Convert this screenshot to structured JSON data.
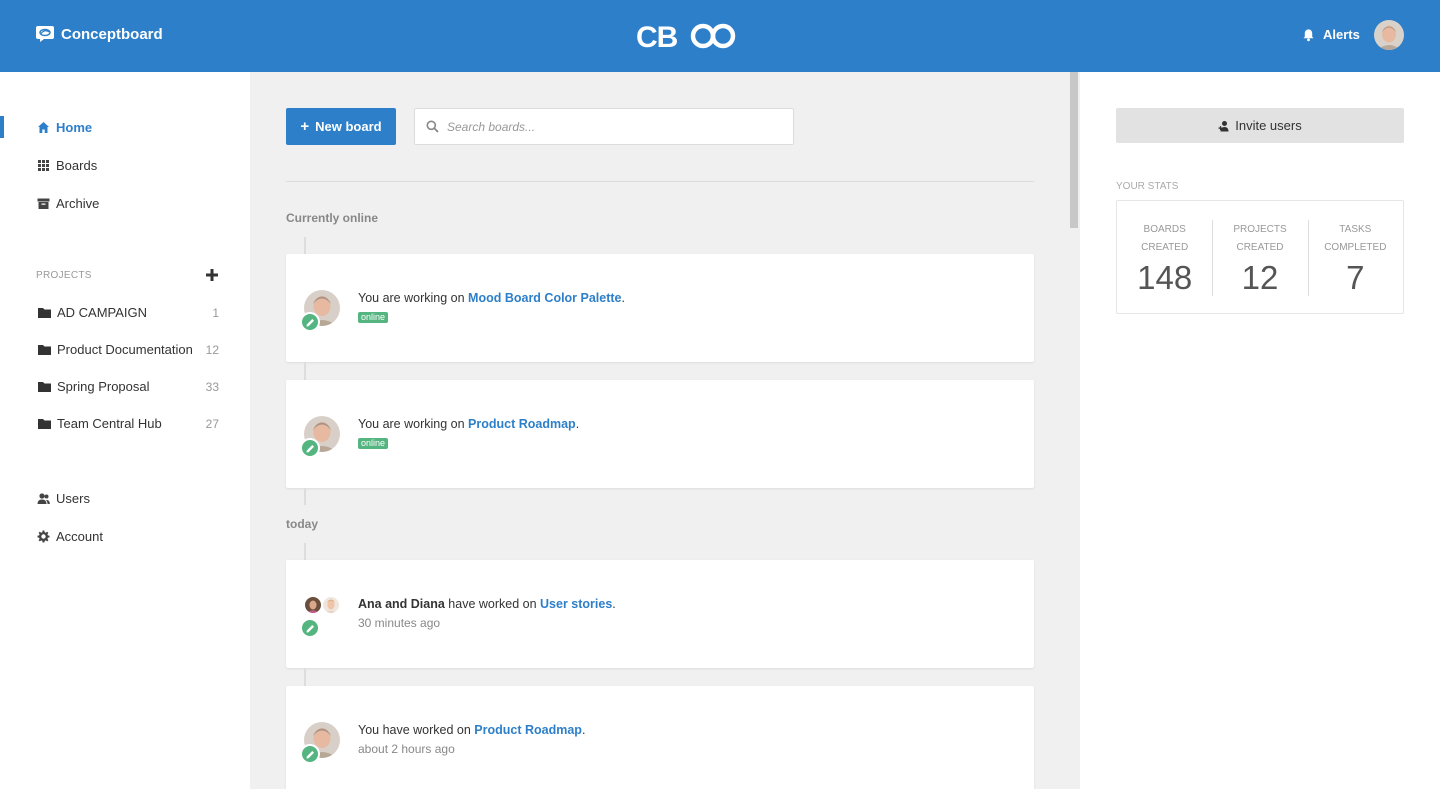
{
  "header": {
    "brand_name": "Conceptboard",
    "logo_text": "CB",
    "alerts_label": "Alerts",
    "accent": "#2d7fc9"
  },
  "sidebar": {
    "nav": [
      {
        "label": "Home",
        "icon": "home-icon",
        "active": true
      },
      {
        "label": "Boards",
        "icon": "grid-icon"
      },
      {
        "label": "Archive",
        "icon": "archive-icon"
      }
    ],
    "projects_label": "PROJECTS",
    "projects": [
      {
        "name": "AD CAMPAIGN",
        "count": "1"
      },
      {
        "name": "Product Documentation",
        "count": "12"
      },
      {
        "name": "Spring Proposal",
        "count": "33"
      },
      {
        "name": "Team Central Hub",
        "count": "27"
      }
    ],
    "bottom_nav": [
      {
        "label": "Users",
        "icon": "users-icon"
      },
      {
        "label": "Account",
        "icon": "gear-icon"
      }
    ]
  },
  "main": {
    "new_board_label": "New board",
    "search_placeholder": "Search boards...",
    "groups": {
      "online": "Currently online",
      "today": "today"
    },
    "activities": [
      {
        "prefix": "You are working on ",
        "board": "Mood Board Color Palette",
        "suffix": ".",
        "status": "online"
      },
      {
        "prefix": "You are working on ",
        "board": "Product Roadmap",
        "suffix": ".",
        "status": "online"
      },
      {
        "actor": "Ana and Diana",
        "prefix": " have worked on ",
        "board": "User stories",
        "suffix": ".",
        "time": "30 minutes ago"
      },
      {
        "prefix": "You have worked on ",
        "board": "Product Roadmap",
        "suffix": ".",
        "time": "about 2 hours ago"
      }
    ]
  },
  "right": {
    "invite_label": "Invite users",
    "stats_label": "YOUR STATS",
    "stats": [
      {
        "label": "BOARDS\nCREATED",
        "value": "148"
      },
      {
        "label": "PROJECTS\nCREATED",
        "value": "12"
      },
      {
        "label": "TASKS\nCOMPLETED",
        "value": "7"
      }
    ]
  }
}
